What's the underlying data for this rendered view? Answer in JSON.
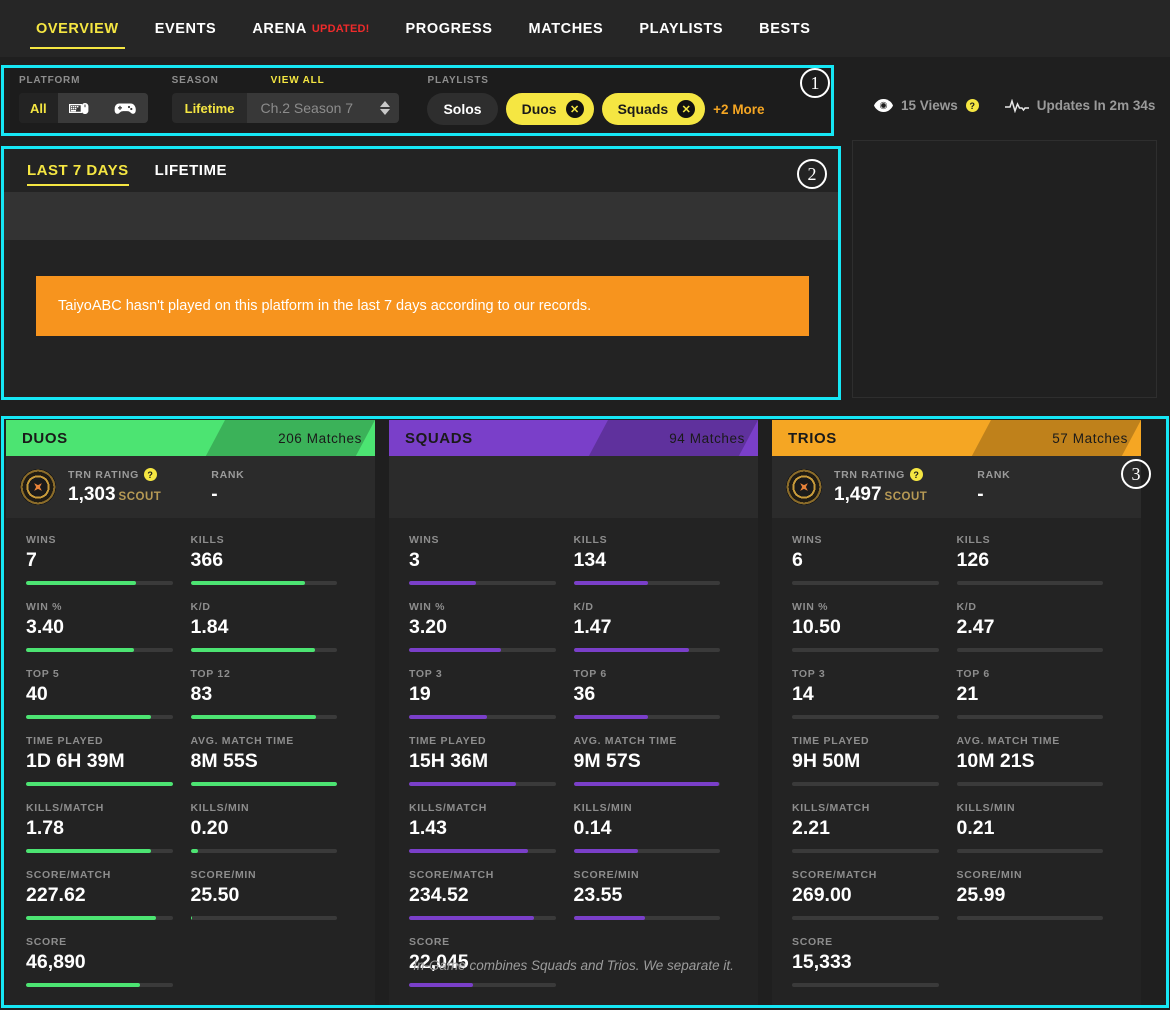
{
  "nav": {
    "tabs": [
      {
        "label": "OVERVIEW",
        "active": true,
        "badge": ""
      },
      {
        "label": "EVENTS",
        "active": false,
        "badge": ""
      },
      {
        "label": "ARENA",
        "active": false,
        "badge": "UPDATED!"
      },
      {
        "label": "PROGRESS",
        "active": false,
        "badge": ""
      },
      {
        "label": "MATCHES",
        "active": false,
        "badge": ""
      },
      {
        "label": "PLAYLISTS",
        "active": false,
        "badge": ""
      },
      {
        "label": "BESTS",
        "active": false,
        "badge": ""
      }
    ]
  },
  "filters": {
    "platform_label": "PLATFORM",
    "platform_all": "All",
    "season_label": "SEASON",
    "view_all_label": "VIEW ALL",
    "season_lifetime": "Lifetime",
    "season_selected": "Ch.2 Season 7",
    "playlists_label": "PLAYLISTS",
    "chips": [
      {
        "label": "Solos",
        "selected": false
      },
      {
        "label": "Duos",
        "selected": true
      },
      {
        "label": "Squads",
        "selected": true
      }
    ],
    "more_label": "+2 More"
  },
  "meta": {
    "views": "15 Views",
    "views_help": "?",
    "updates": "Updates In 2m 34s"
  },
  "period": {
    "tabs": [
      {
        "label": "LAST 7 DAYS",
        "active": true
      },
      {
        "label": "LIFETIME",
        "active": false
      }
    ],
    "alert": "TaiyoABC hasn't played on this platform in the last 7 days according to our records."
  },
  "annotations": {
    "one": "1",
    "two": "2",
    "three": "3"
  },
  "cards": [
    {
      "title": "DUOS",
      "matches": "206 Matches",
      "accent": "#4ce472",
      "bar_color": "#4ce472",
      "has_rating": true,
      "rating_label": "TRN RATING",
      "rating_value": "1,303",
      "rating_tier": "SCOUT",
      "rank_label": "RANK",
      "rank_value": "-",
      "note": "",
      "stats": [
        {
          "label": "WINS",
          "value": "7",
          "pct": 75
        },
        {
          "label": "KILLS",
          "value": "366",
          "pct": 78
        },
        {
          "label": "WIN %",
          "value": "3.40",
          "pct": 74
        },
        {
          "label": "K/D",
          "value": "1.84",
          "pct": 85
        },
        {
          "label": "TOP 5",
          "value": "40",
          "pct": 85
        },
        {
          "label": "TOP 12",
          "value": "83",
          "pct": 86
        },
        {
          "label": "TIME PLAYED",
          "value": "1D 6H 39M",
          "pct": 100
        },
        {
          "label": "AVG. MATCH TIME",
          "value": "8M 55S",
          "pct": 100
        },
        {
          "label": "KILLS/MATCH",
          "value": "1.78",
          "pct": 85
        },
        {
          "label": "KILLS/MIN",
          "value": "0.20",
          "pct": 5
        },
        {
          "label": "SCORE/MATCH",
          "value": "227.62",
          "pct": 89
        },
        {
          "label": "SCORE/MIN",
          "value": "25.50",
          "pct": 1
        },
        {
          "label": "SCORE",
          "value": "46,890",
          "pct": 78
        }
      ]
    },
    {
      "title": "SQUADS",
      "matches": "94 Matches",
      "accent": "#7a3fc9",
      "bar_color": "#7a3fc9",
      "has_rating": false,
      "rating_label": "",
      "rating_value": "",
      "rating_tier": "",
      "rank_label": "",
      "rank_value": "",
      "note": "In-Game combines Squads and Trios. We separate it.",
      "stats": [
        {
          "label": "WINS",
          "value": "3",
          "pct": 46
        },
        {
          "label": "KILLS",
          "value": "134",
          "pct": 51
        },
        {
          "label": "WIN %",
          "value": "3.20",
          "pct": 63
        },
        {
          "label": "K/D",
          "value": "1.47",
          "pct": 79
        },
        {
          "label": "TOP 3",
          "value": "19",
          "pct": 53
        },
        {
          "label": "TOP 6",
          "value": "36",
          "pct": 51
        },
        {
          "label": "TIME PLAYED",
          "value": "15H 36M",
          "pct": 73
        },
        {
          "label": "AVG. MATCH TIME",
          "value": "9M 57S",
          "pct": 99
        },
        {
          "label": "KILLS/MATCH",
          "value": "1.43",
          "pct": 81
        },
        {
          "label": "KILLS/MIN",
          "value": "0.14",
          "pct": 44
        },
        {
          "label": "SCORE/MATCH",
          "value": "234.52",
          "pct": 85
        },
        {
          "label": "SCORE/MIN",
          "value": "23.55",
          "pct": 49
        },
        {
          "label": "SCORE",
          "value": "22,045",
          "pct": 44
        }
      ]
    },
    {
      "title": "TRIOS",
      "matches": "57 Matches",
      "accent": "#f5a623",
      "bar_color": "#555555",
      "has_rating": true,
      "rating_label": "TRN RATING",
      "rating_value": "1,497",
      "rating_tier": "SCOUT",
      "rank_label": "RANK",
      "rank_value": "-",
      "note": "",
      "stats": [
        {
          "label": "WINS",
          "value": "6",
          "pct": 0
        },
        {
          "label": "KILLS",
          "value": "126",
          "pct": 0
        },
        {
          "label": "WIN %",
          "value": "10.50",
          "pct": 0
        },
        {
          "label": "K/D",
          "value": "2.47",
          "pct": 0
        },
        {
          "label": "TOP 3",
          "value": "14",
          "pct": 0
        },
        {
          "label": "TOP 6",
          "value": "21",
          "pct": 0
        },
        {
          "label": "TIME PLAYED",
          "value": "9H 50M",
          "pct": 0
        },
        {
          "label": "AVG. MATCH TIME",
          "value": "10M 21S",
          "pct": 0
        },
        {
          "label": "KILLS/MATCH",
          "value": "2.21",
          "pct": 0
        },
        {
          "label": "KILLS/MIN",
          "value": "0.21",
          "pct": 0
        },
        {
          "label": "SCORE/MATCH",
          "value": "269.00",
          "pct": 0
        },
        {
          "label": "SCORE/MIN",
          "value": "25.99",
          "pct": 0
        },
        {
          "label": "SCORE",
          "value": "15,333",
          "pct": 0
        }
      ]
    }
  ]
}
